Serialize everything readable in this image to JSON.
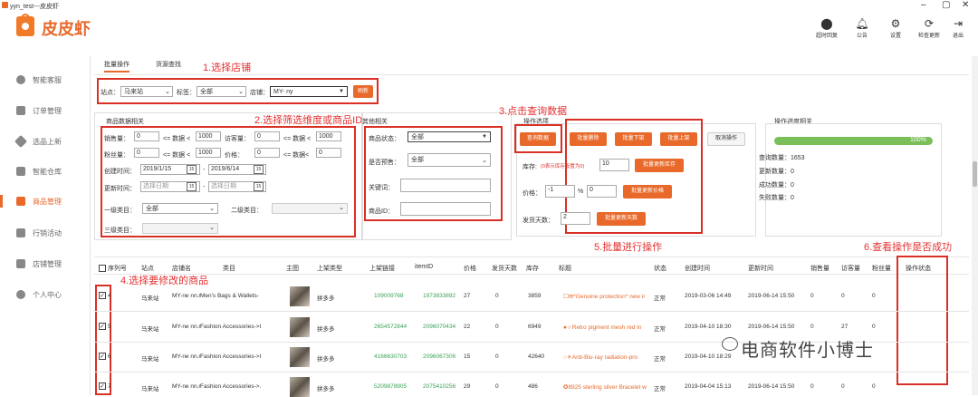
{
  "window": {
    "title": "yyn_test---皮皮虾",
    "controls": [
      "–",
      "▢",
      "✕"
    ]
  },
  "brand": {
    "name": "皮皮虾"
  },
  "toolbar": [
    {
      "label": "超时回复",
      "icon": "toggle-icon"
    },
    {
      "label": "公告",
      "icon": "bell-icon"
    },
    {
      "label": "设置",
      "icon": "gear-icon"
    },
    {
      "label": "检查更新",
      "icon": "refresh-icon"
    },
    {
      "label": "退出",
      "icon": "logout-icon"
    }
  ],
  "sidebar": {
    "items": [
      {
        "label": "智能客服",
        "icon": "headset-icon"
      },
      {
        "label": "订单管理",
        "icon": "order-icon"
      },
      {
        "label": "选品上新",
        "icon": "tag-icon"
      },
      {
        "label": "智能仓库",
        "icon": "warehouse-icon"
      },
      {
        "label": "商品管理",
        "icon": "goods-icon",
        "active": true
      },
      {
        "label": "行销活动",
        "icon": "activity-icon"
      },
      {
        "label": "店铺管理",
        "icon": "store-icon"
      },
      {
        "label": "个人中心",
        "icon": "user-icon"
      }
    ]
  },
  "tabs": [
    "批量操作",
    "货源查找"
  ],
  "annotations": {
    "a1": "1.选择店铺",
    "a2": "2.选择筛选维度或商品ID",
    "a3": "3.点击查询数据",
    "a4": "4.选择要修改的商品",
    "a5": "5.批量进行操作",
    "a6": "6.查看操作是否成功"
  },
  "store_bar": {
    "site_label": "站点：",
    "site_value": "马来站",
    "tag_label": "标签：",
    "tag_value": "全部",
    "store_label": "店铺：",
    "store_value": "MY-                ny",
    "refresh_label": "刷新"
  },
  "product_filter": {
    "header": "商品数据相关",
    "sales_label": "销售量：",
    "sales_min": "0",
    "sales_max": "1000",
    "visits_label": "访客量：",
    "visits_min": "0",
    "visits_max": "1000",
    "fans_label": "粉丝量：",
    "fans_min": "0",
    "fans_max": "1000",
    "price_label": "价格：",
    "price_min": "0",
    "price_max": "0",
    "lt_text": "<= 数据 <",
    "lte_text": "<= 数据<",
    "create_label": "创建时间：",
    "create_from": "2019/1/15",
    "create_to": "2019/6/14",
    "update_label": "更新时间：",
    "update_from": "选择日期",
    "update_to": "选择日期",
    "cat1_label": "一级类目：",
    "cat1_value": "全部",
    "cat2_label": "二级类目：",
    "cat3_label": "三级类目：",
    "dash": "-",
    "cal_icon": "15"
  },
  "other_filter": {
    "header": "其他相关",
    "status_label": "商品状态：",
    "status_value": "全部",
    "presale_label": "是否预售：",
    "presale_value": "全部",
    "keyword_label": "关键词：",
    "itemid_label": "商品ID："
  },
  "ops": {
    "header": "操作选项",
    "query": "查询数据",
    "batch_delete": "批量删除",
    "batch_off": "批量下架",
    "batch_on": "批量上架",
    "cancel": "取消操作",
    "stock_label": "库存:",
    "stock_hint": "(0表示库存设置为0)",
    "stock_value": "10",
    "stock_btn": "批量更新库存",
    "price_label": "价格：",
    "price_value": "-1",
    "percent": "%",
    "price_value2": "0",
    "price_btn": "批量更新价格",
    "days_label": "发货天数：",
    "days_value": "2",
    "days_btn": "批量更新天数"
  },
  "progress": {
    "header": "操作进度相关",
    "percent": "100%",
    "query_count": "查询数量：1653",
    "update_count": "更新数量：0",
    "success_count": "成功数量：0",
    "fail_count": "失败数量：0"
  },
  "table": {
    "headers": [
      "序列号",
      "站点",
      "店铺名",
      "类目",
      "主图",
      "上架类型",
      "上架链接",
      "itemID",
      "价格",
      "发货天数",
      "库存",
      "标题",
      "状态",
      "创建时间",
      "更新时间",
      "销售量",
      "访客量",
      "粉丝量",
      "操作状态"
    ],
    "rows": [
      {
        "seq": "4",
        "site": "马来站",
        "store": "MY-ne      nn.r",
        "category": "Men's Bags & Wallets-",
        "type": "拼多多",
        "link": "109009768",
        "itemid": "1973833892",
        "price": "27",
        "days": "0",
        "stock": "3859",
        "title": "☐✉*Genuine protection* new ir",
        "status": "正常",
        "created": "2019-03-06 14:49",
        "updated": "2019-06-14 15:50",
        "sales": "0",
        "visits": "0",
        "fans": "0"
      },
      {
        "seq": "5",
        "site": "马来站",
        "store": "MY-ne     nn.r",
        "category": "Fashion Accessories->I",
        "type": "拼多多",
        "link": "2654572844",
        "itemid": "2096070434",
        "price": "22",
        "days": "0",
        "stock": "6949",
        "title": "●☆Retro pigment mesh red in",
        "status": "正常",
        "created": "2019-04-10 18:30",
        "updated": "2019-06-14 15:50",
        "sales": "0",
        "visits": "27",
        "fans": "0"
      },
      {
        "seq": "6",
        "site": "马来站",
        "store": "MY-ne     nn.r",
        "category": "Fashion Accessories->I",
        "type": "拼多多",
        "link": "4166630703",
        "itemid": "2096067306",
        "price": "15",
        "days": "0",
        "stock": "42640",
        "title": "○☀Anti-Blu-ray radiation-pro",
        "status": "正常",
        "created": "2019-04-10 18:29",
        "updated": "",
        "sales": "",
        "visits": "",
        "fans": ""
      },
      {
        "seq": "7",
        "site": "马来站",
        "store": "MY-ne     nn.r",
        "category": "Fashion Accessories->.",
        "type": "拼多多",
        "link": "5209878905",
        "itemid": "2075410256",
        "price": "29",
        "days": "0",
        "stock": "486",
        "title": "✪8925 sterling silver Bracelet w",
        "status": "正常",
        "created": "2019-04-04 15:13",
        "updated": "2019-06-14 15:50",
        "sales": "0",
        "visits": "0",
        "fans": "0"
      }
    ]
  },
  "watermark": "电商软件小博士",
  "colors": {
    "accent": "#e8692a",
    "annotation": "#e53030",
    "progress": "#7abf5a",
    "link": "#3aa357"
  }
}
